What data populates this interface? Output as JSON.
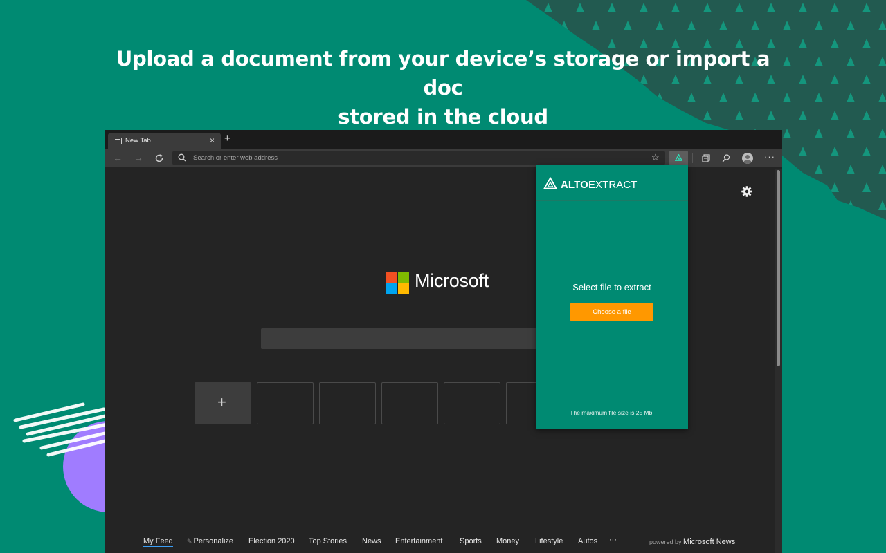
{
  "headline": {
    "line1": "Upload a document from your device’s storage or import a doc",
    "line2": "stored in the cloud"
  },
  "browser": {
    "tab_title": "New Tab",
    "tab_close": "×",
    "new_tab": "+",
    "back": "←",
    "forward": "→",
    "address_placeholder": "Search or enter web address",
    "favorite": "☆",
    "more": "···"
  },
  "newtab": {
    "brand": "Microsoft",
    "add_tile": "+",
    "feed": {
      "items": [
        "My Feed",
        "Personalize",
        "Election 2020",
        "Top Stories",
        "News",
        "Entertainment",
        "Sports",
        "Money",
        "Lifestyle",
        "Autos",
        "···"
      ],
      "powered_prefix": "powered by",
      "powered_brand": "Microsoft News"
    }
  },
  "extension": {
    "brand_bold": "ALTO",
    "brand_rest": "EXTRACT",
    "select_title": "Select file to extract",
    "choose_button": "Choose a file",
    "max_size_note": "The maximum file size is 25 Mb."
  },
  "colors": {
    "brand_green": "#008a72",
    "accent_orange": "#ff9800",
    "lilac": "#a07cff"
  },
  "icons": [
    "favicon-icon",
    "close-icon",
    "back-icon",
    "forward-icon",
    "refresh-icon",
    "search-icon",
    "star-icon",
    "alto-extract-icon",
    "collections-icon",
    "feedback-icon",
    "profile-avatar",
    "gear-icon",
    "microsoft-logo"
  ]
}
